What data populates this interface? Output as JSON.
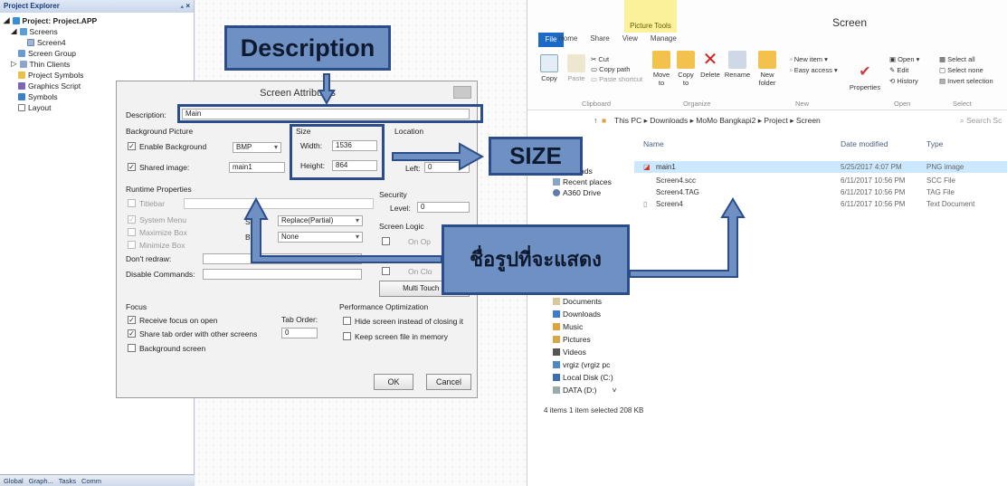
{
  "explorer": {
    "title": "Project Explorer",
    "pin_controls": "₄ ×",
    "tree": [
      {
        "label": "Project: Project.APP",
        "bold": true
      },
      {
        "label": "Screens"
      },
      {
        "label": "Screen4"
      },
      {
        "label": "Screen Group"
      },
      {
        "label": "Thin Clients"
      },
      {
        "label": "Project Symbols"
      },
      {
        "label": "Graphics Script"
      },
      {
        "label": "Symbols"
      },
      {
        "label": "Layout"
      }
    ],
    "bottom_tabs": [
      "Global",
      "Graph...",
      "Tasks",
      "Comm"
    ]
  },
  "dialog": {
    "title": "Screen Attributes",
    "description_label": "Description:",
    "description_value": "Main",
    "background_group": "Background Picture",
    "enable_background_label": "Enable Background",
    "enable_background_checked": true,
    "background_type": "BMP",
    "shared_image_label": "Shared image:",
    "shared_image_checked": true,
    "shared_image_value": "main1",
    "size_group": "Size",
    "width_label": "Width:",
    "width_value": "1536",
    "height_label": "Height:",
    "height_value": "864",
    "location_group": "Location",
    "left_label": "Left:",
    "left_value": "0",
    "runtime_group": "Runtime Properties",
    "titlebar_label": "Titlebar",
    "system_menu_label": "System Menu",
    "maximize_label": "Maximize Box",
    "minimize_label": "Minimize Box",
    "style_label": "St",
    "style_value": "Replace(Partial)",
    "border_label": "Bo",
    "border_value": "None",
    "dont_redraw_label": "Don't redraw:",
    "disable_commands_label": "Disable Commands:",
    "security_group": "Security",
    "level_label": "Level:",
    "level_value": "0",
    "screen_logic_group": "Screen Logic",
    "on_open_label": "On Op",
    "on_close_label": "On Clo",
    "multi_touch_label": "Multi Touch S",
    "focus_group": "Focus",
    "receive_focus_label": "Receive focus on open",
    "share_tab_label": "Share tab order with other screens",
    "background_screen_label": "Background screen",
    "tab_order_label": "Tab Order:",
    "tab_order_value": "0",
    "perf_group": "Performance Optimization",
    "hide_screen_label": "Hide screen instead of closing it",
    "keep_screen_label": "Keep screen file in memory",
    "ok_label": "OK",
    "cancel_label": "Cancel"
  },
  "file_explorer": {
    "window_title": "Screen",
    "picture_tools": "Picture Tools",
    "tabs": [
      "File",
      "Home",
      "Share",
      "View",
      "Manage"
    ],
    "ribbon": {
      "cut": "Cut",
      "copy_path": "Copy path",
      "paste_shortcut": "Paste shortcut",
      "copy": "Copy",
      "paste": "Paste",
      "clipboard": "Clipboard",
      "move_to": "Move to",
      "copy_to": "Copy to",
      "delete": "Delete",
      "rename": "Rename",
      "new_folder": "New folder",
      "organize": "Organize",
      "new_item": "New item",
      "easy_access": "Easy access",
      "new": "New",
      "properties": "Properties",
      "open": "Open",
      "edit": "Edit",
      "history": "History",
      "open_group": "Open",
      "select_all": "Select all",
      "select_none": "Select none",
      "invert_selection": "Invert selection",
      "select_group": "Select"
    },
    "breadcrumb": "This PC ▸ Downloads ▸ MoMo Bangkapi2 ▸ Project ▸ Screen",
    "search_placeholder": "Search Sc",
    "nav": [
      "ads",
      "Recent places",
      "A360 Drive",
      "Documents",
      "Downloads",
      "Music",
      "Pictures",
      "Videos",
      "vrgiz (vrgiz pc",
      "Local Disk (C:)",
      "DATA (D:)"
    ],
    "columns": [
      "Name",
      "Date modified",
      "Type"
    ],
    "files": [
      {
        "name": "main1",
        "date": "5/25/2017 4:07 PM",
        "type": "PNG image",
        "selected": true
      },
      {
        "name": "Screen4.scc",
        "date": "6/11/2017 10:56 PM",
        "type": "SCC File",
        "selected": false
      },
      {
        "name": "Screen4.TAG",
        "date": "6/11/2017 10:56 PM",
        "type": "TAG File",
        "selected": false
      },
      {
        "name": "Screen4",
        "date": "6/11/2017 10:56 PM",
        "type": "Text Document",
        "selected": false
      }
    ],
    "status": "4 items    1 item selected  208 KB"
  },
  "callouts": {
    "description": "Description",
    "size": "SIZE",
    "picture": "ชื่อรูปที่จะแสดง"
  },
  "colors": {
    "callout_fill": "#6f90c3",
    "callout_border": "#2b4d89",
    "selected_row": "#cce8ff"
  }
}
